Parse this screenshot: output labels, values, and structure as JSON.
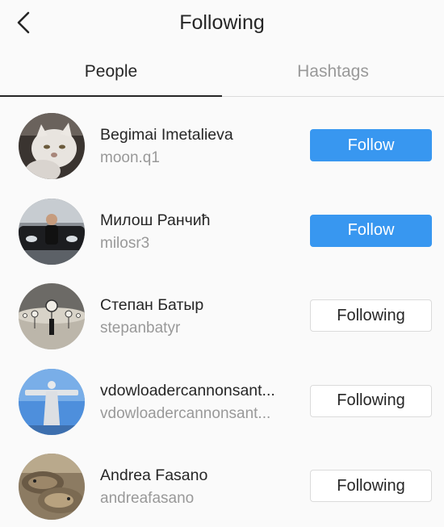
{
  "header": {
    "title": "Following",
    "back_icon": "chevron-left-icon"
  },
  "tabs": [
    {
      "label": "People",
      "active": true
    },
    {
      "label": "Hashtags",
      "active": false
    }
  ],
  "colors": {
    "accent": "#3897f0",
    "text": "#262626",
    "muted": "#999999",
    "border": "#dbdbdb",
    "background": "#fafafa"
  },
  "people": [
    {
      "name": "Begimai Imetalieva",
      "username": "moon.q1",
      "button": "Follow",
      "following": false
    },
    {
      "name": "Милош Ранчић",
      "username": "milosr3",
      "button": "Follow",
      "following": false
    },
    {
      "name": "Степан Батыр",
      "username": "stepanbatyr",
      "button": "Following",
      "following": true
    },
    {
      "name": "vdowloadercannonsant...",
      "username": "vdowloadercannonsant...",
      "button": "Following",
      "following": true
    },
    {
      "name": "Andrea Fasano",
      "username": "andreafasano",
      "button": "Following",
      "following": true
    }
  ]
}
